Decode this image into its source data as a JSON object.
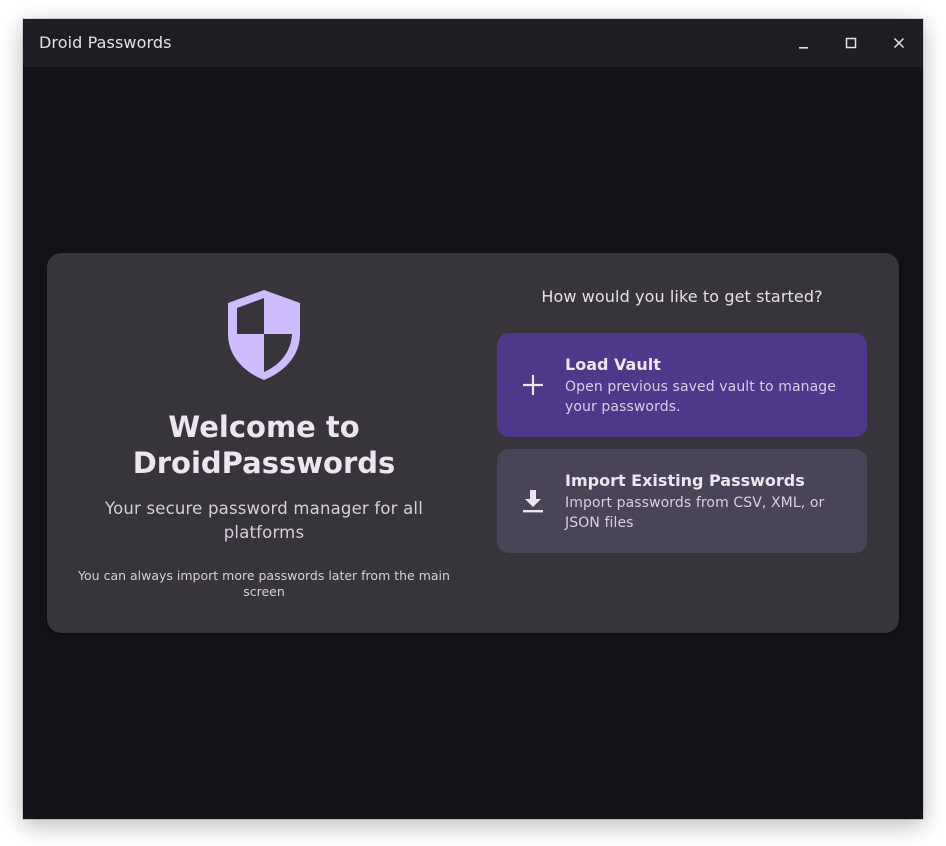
{
  "window": {
    "title": "Droid Passwords",
    "controls": {
      "minimize_icon": "minimize-icon",
      "maximize_icon": "maximize-icon",
      "close_icon": "close-icon"
    }
  },
  "welcome": {
    "shield_icon": "shield-icon",
    "heading_line1": "Welcome to",
    "heading_line2": "DroidPasswords",
    "tagline": "Your secure password manager for all platforms",
    "note": "You can always import more passwords later from the main screen"
  },
  "start": {
    "question": "How would you like to get started?",
    "options": [
      {
        "icon": "plus-icon",
        "title": "Load Vault",
        "description": "Open previous saved vault to manage your passwords."
      },
      {
        "icon": "download-icon",
        "title": "Import Existing Passwords",
        "description": "Import passwords from CSV, XML, or JSON files"
      }
    ]
  },
  "colors": {
    "window_bg": "#141218",
    "titlebar_bg": "#1f1d24",
    "card_bg": "#37343c",
    "accent_primary": "#4f378a",
    "accent_secondary": "#4a4458",
    "shield": "#cfbcff",
    "text": "#ece6f0"
  }
}
